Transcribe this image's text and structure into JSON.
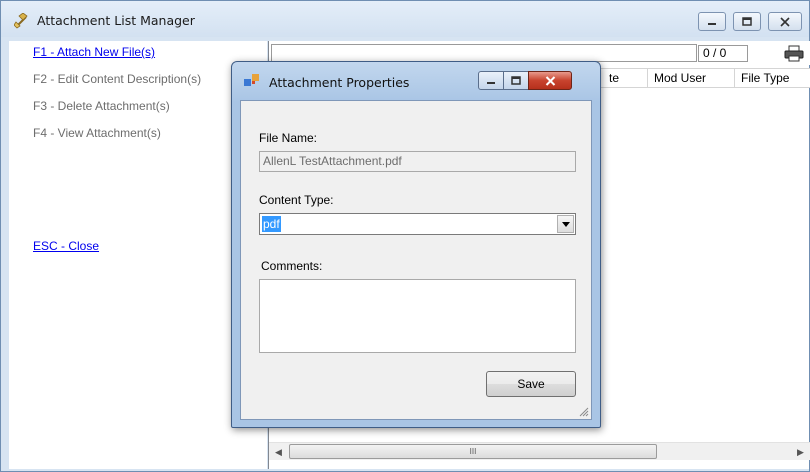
{
  "main_window": {
    "title": "Attachment List Manager",
    "commands": [
      {
        "label": "F1 - Attach New File(s)",
        "state": "link"
      },
      {
        "label": "F2 - Edit Content Description(s)",
        "state": "disabled"
      },
      {
        "label": "F3 - Delete Attachment(s)",
        "state": "disabled"
      },
      {
        "label": "F4 - View Attachment(s)",
        "state": "disabled"
      },
      {
        "label": "ESC - Close",
        "state": "link"
      }
    ],
    "page_counter": "0 / 0",
    "columns": [
      "te",
      "Mod User",
      "File Type"
    ],
    "scroll_thumb_glyph": "III"
  },
  "dialog": {
    "title": "Attachment Properties",
    "file_name_label": "File Name:",
    "file_name_value": "AllenL TestAttachment.pdf",
    "content_type_label": "Content Type:",
    "content_type_value": "pdf",
    "comments_label": "Comments:",
    "comments_value": "",
    "save_label": "Save"
  },
  "colors": {
    "link": "#0000ee",
    "disabled_text": "#6d6d6d",
    "selection": "#3399ff",
    "close_button": "#c8432e",
    "window_frame": "#d7e4f2"
  },
  "icons": [
    "app-icon",
    "minimize-icon",
    "maximize-icon",
    "close-icon",
    "print-icon",
    "dialog-window-icon",
    "dropdown-arrow-icon",
    "resize-grip-icon",
    "scroll-left-icon",
    "scroll-right-icon"
  ]
}
